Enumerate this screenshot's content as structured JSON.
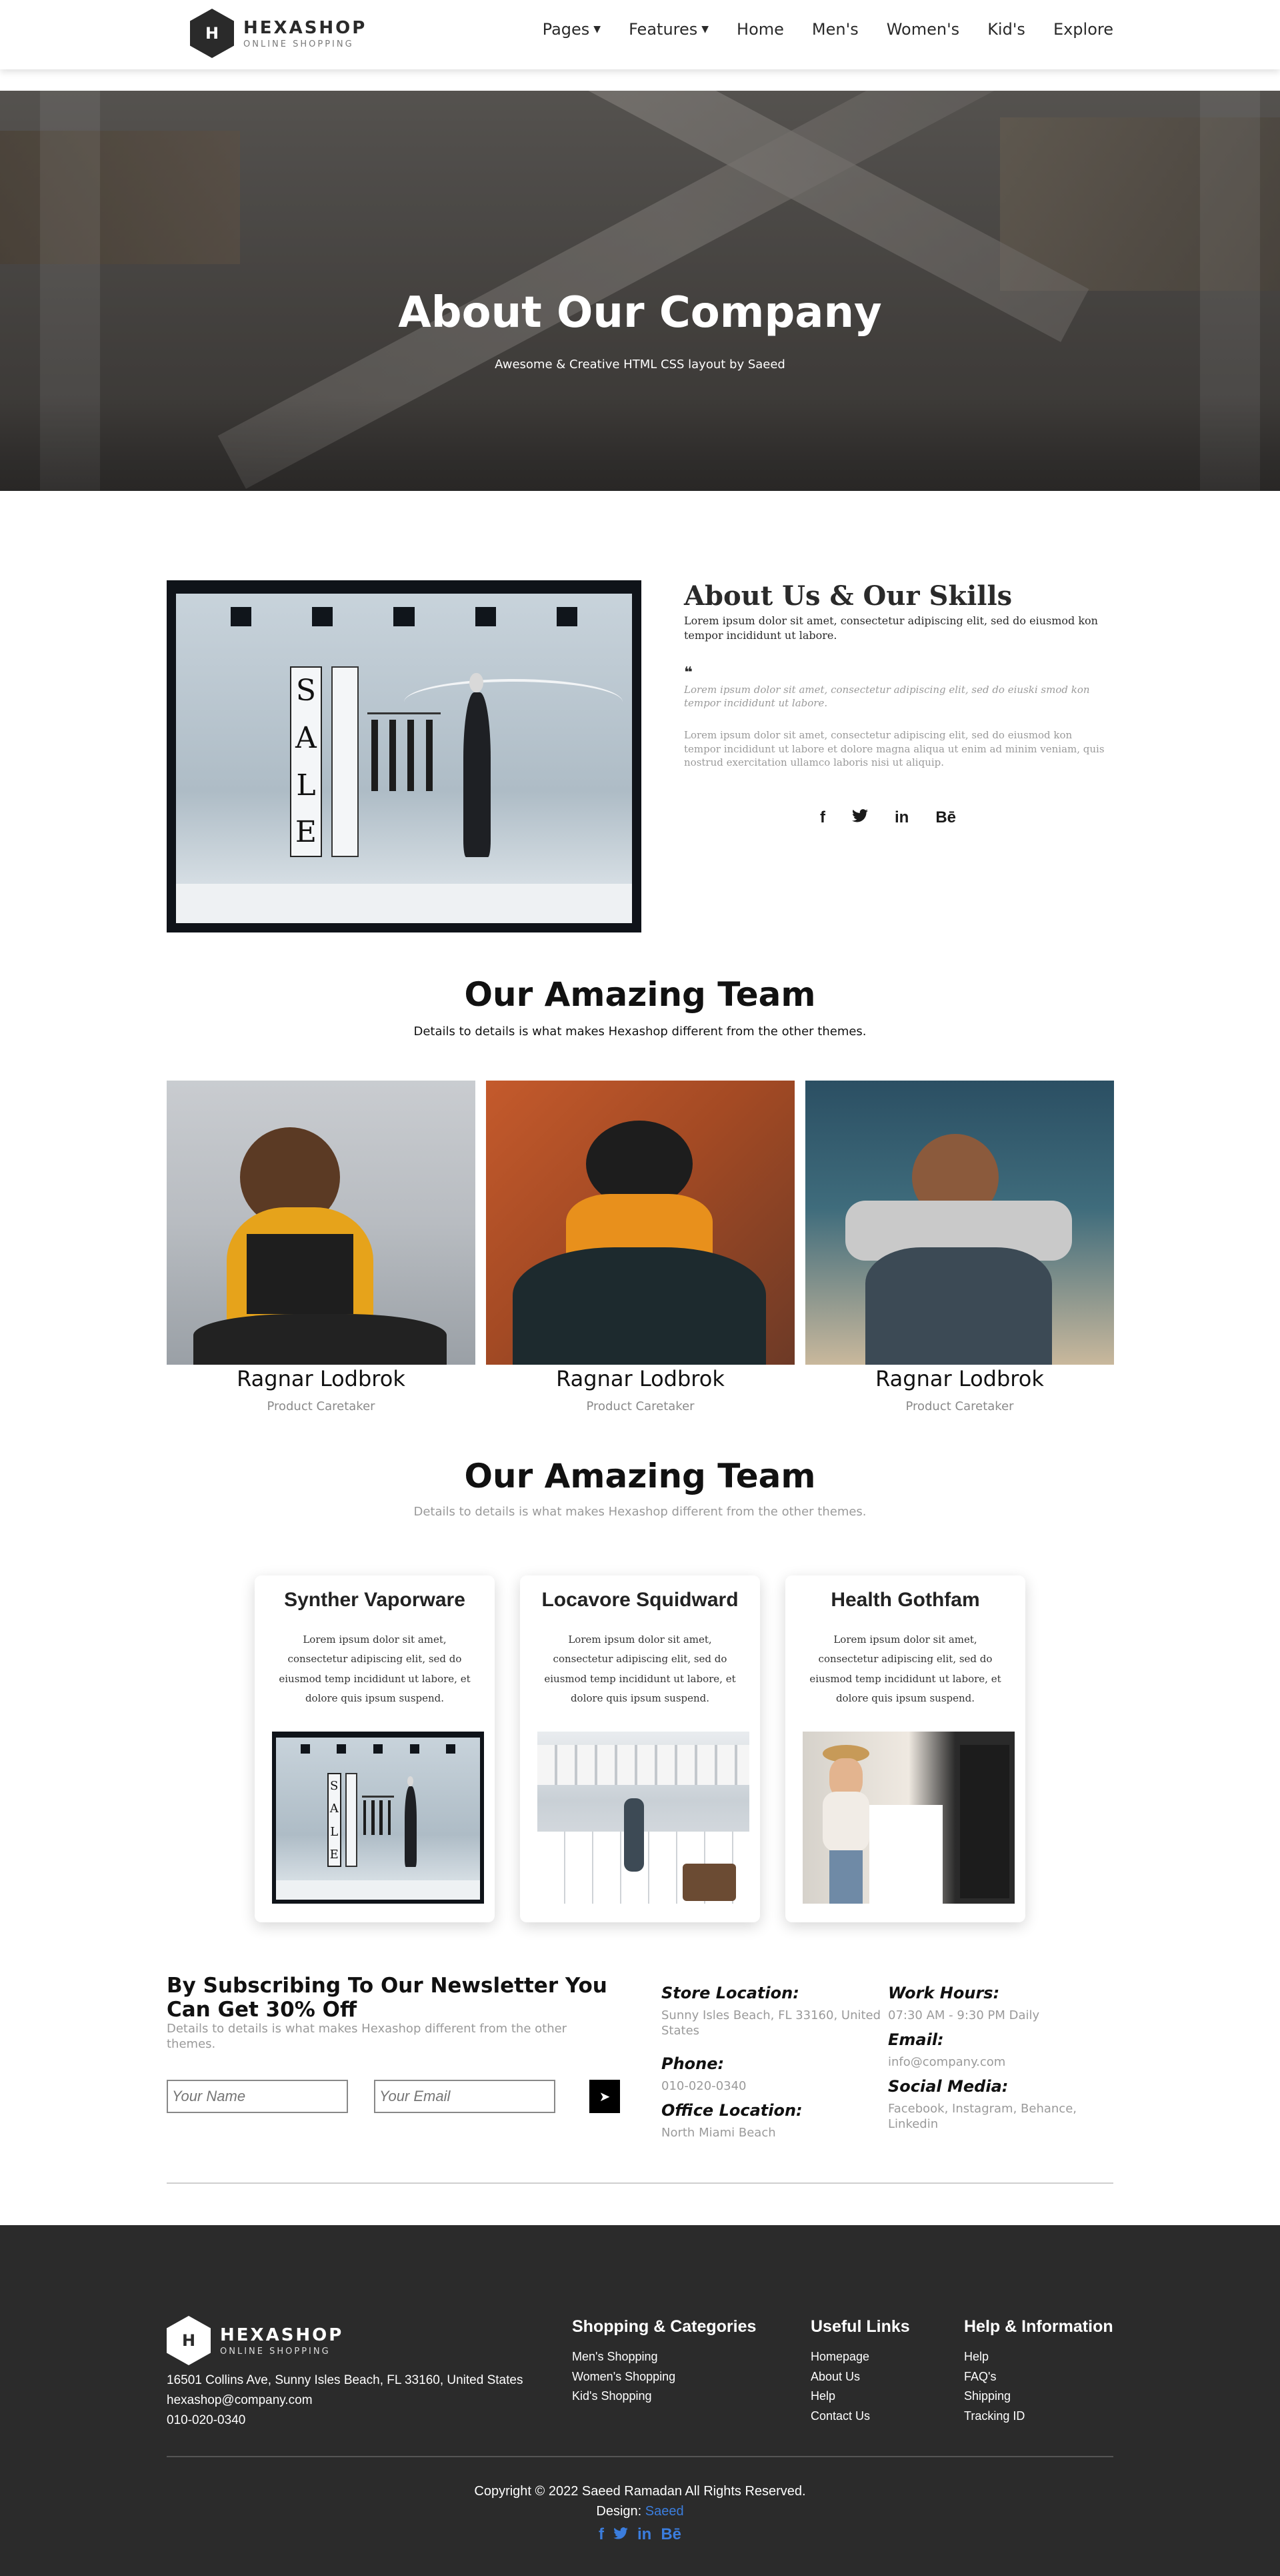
{
  "brand": {
    "name": "HEXASHOP",
    "tagline": "ONLINE SHOPPING",
    "mark": "H"
  },
  "nav": {
    "items": [
      {
        "label": "Pages",
        "dropdown": true
      },
      {
        "label": "Features",
        "dropdown": true
      },
      {
        "label": "Home",
        "dropdown": false
      },
      {
        "label": "Men's",
        "dropdown": false
      },
      {
        "label": "Women's",
        "dropdown": false
      },
      {
        "label": "Kid's",
        "dropdown": false
      },
      {
        "label": "Explore",
        "dropdown": false
      }
    ]
  },
  "hero": {
    "title": "About Our Company",
    "subtitle": "Awesome & Creative HTML CSS layout by Saeed"
  },
  "about": {
    "title": "About Us & Our Skills",
    "paragraph": "Lorem ipsum dolor sit amet, consectetur adipiscing elit, sed do eiusmod kon tempor incididunt ut labore.",
    "quote": "Lorem ipsum dolor sit amet, consectetur adipiscing elit, sed do eiuski smod kon tempor incididunt ut labore.",
    "paragraph2": "Lorem ipsum dolor sit amet, consectetur adipiscing elit, sed do eiusmod kon tempor incididunt ut labore et dolore magna aliqua ut enim ad minim veniam, quis nostrud exercitation ullamco laboris nisi ut aliquip.",
    "socials": [
      "f",
      "t",
      "in",
      "Bē"
    ],
    "sign_text": "SALE"
  },
  "team": {
    "title": "Our Amazing Team",
    "subtitle": "Details to details is what makes Hexashop different from the other themes.",
    "members": [
      {
        "name": "Ragnar Lodbrok",
        "role": "Product Caretaker"
      },
      {
        "name": "Ragnar Lodbrok",
        "role": "Product Caretaker"
      },
      {
        "name": "Ragnar Lodbrok",
        "role": "Product Caretaker"
      }
    ]
  },
  "team2": {
    "title": "Our Amazing Team",
    "subtitle": "Details to details is what makes Hexashop different from the other themes.",
    "cards": [
      {
        "title": "Synther Vaporware",
        "text": "Lorem ipsum dolor sit amet, consectetur adipiscing elit, sed do eiusmod temp incididunt ut labore, et dolore quis ipsum suspend."
      },
      {
        "title": "Locavore Squidward",
        "text": "Lorem ipsum dolor sit amet, consectetur adipiscing elit, sed do eiusmod temp incididunt ut labore, et dolore quis ipsum suspend."
      },
      {
        "title": "Health Gothfam",
        "text": "Lorem ipsum dolor sit amet, consectetur adipiscing elit, sed do eiusmod temp incididunt ut labore, et dolore quis ipsum suspend."
      }
    ]
  },
  "newsletter": {
    "title": "By Subscribing To Our Newsletter You Can Get 30% Off",
    "subtitle": "Details to details is what makes Hexashop different from the other themes.",
    "name_placeholder": "Your Name",
    "email_placeholder": "Your Email",
    "submit_icon": "paper-plane"
  },
  "contact": {
    "store_label": "Store Location:",
    "store_value": "Sunny Isles Beach, FL 33160, United States",
    "phone_label": "Phone:",
    "phone_value": "010-020-0340",
    "office_label": "Office Location:",
    "office_value": "North Miami Beach",
    "hours_label": "Work Hours:",
    "hours_value": "07:30 AM - 9:30 PM Daily",
    "email_label": "Email:",
    "email_value": "info@company.com",
    "social_label": "Social Media:",
    "social_value": "Facebook, Instagram, Behance, Linkedin"
  },
  "footer": {
    "address": "16501 Collins Ave, Sunny Isles Beach, FL 33160, United States",
    "email": "hexashop@company.com",
    "phone": "010-020-0340",
    "col1": {
      "title": "Shopping & Categories",
      "links": [
        "Men's Shopping",
        "Women's Shopping",
        "Kid's Shopping"
      ]
    },
    "col2": {
      "title": "Useful Links",
      "links": [
        "Homepage",
        "About Us",
        "Help",
        "Contact Us"
      ]
    },
    "col3": {
      "title": "Help & Information",
      "links": [
        "Help",
        "FAQ's",
        "Shipping",
        "Tracking ID"
      ]
    },
    "copyright": "Copyright © 2022 Saeed Ramadan All Rights Reserved.",
    "design_label": "Design:",
    "design_author": "Saeed",
    "socials": [
      "f",
      "t",
      "in",
      "Bē"
    ]
  },
  "colors": {
    "dark": "#2b2b2b",
    "accent_blue": "#3b7ddd",
    "muted": "#9a9a9a"
  }
}
